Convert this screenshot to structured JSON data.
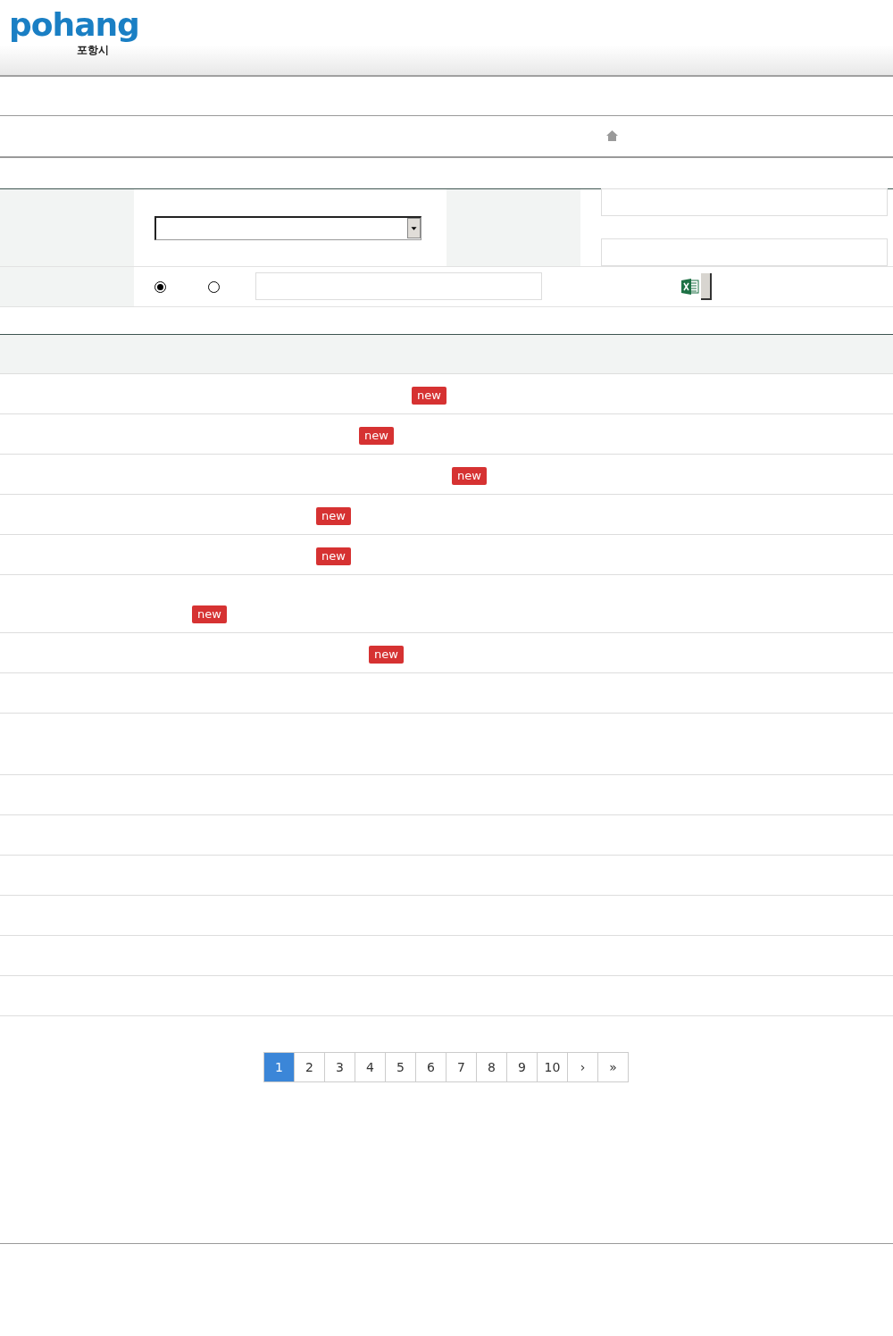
{
  "logo": {
    "wordmark": "pohang",
    "city": "포항시"
  },
  "search_form": {
    "radios": [
      {
        "selected": true
      },
      {
        "selected": false
      }
    ]
  },
  "rows": [
    {
      "badge": "new"
    },
    {
      "badge": "new"
    },
    {
      "badge": "new"
    },
    {
      "badge": "new"
    },
    {
      "badge": "new"
    },
    {
      "badge": "new"
    },
    {
      "badge": "new"
    }
  ],
  "pagination": {
    "pages": [
      {
        "label": "1",
        "selected": true
      },
      {
        "label": "2",
        "selected": false
      },
      {
        "label": "3",
        "selected": false
      },
      {
        "label": "4",
        "selected": false
      },
      {
        "label": "5",
        "selected": false
      },
      {
        "label": "6",
        "selected": false
      },
      {
        "label": "7",
        "selected": false
      },
      {
        "label": "8",
        "selected": false
      },
      {
        "label": "9",
        "selected": false
      },
      {
        "label": "10",
        "selected": false
      }
    ],
    "next": "›",
    "last": "»"
  }
}
